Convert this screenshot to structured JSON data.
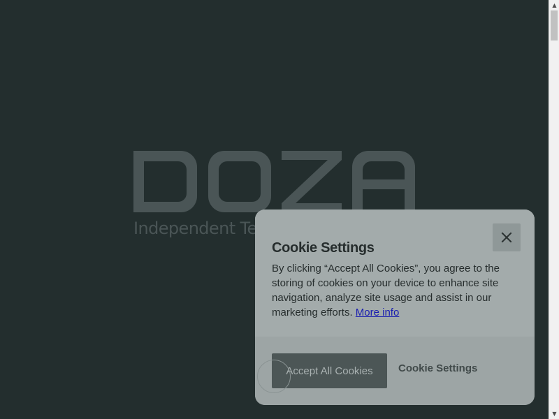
{
  "hero": {
    "logo_text": "DOZA",
    "tagline": "Independent Technology Consultants"
  },
  "cookie_banner": {
    "title": "Cookie Settings",
    "body": "By clicking “Accept All Cookies”, you agree to the storing of cookies on your device to enhance site navigation, analyze site usage and assist in our marketing efforts.",
    "more_info_label": "More info",
    "accept_label": "Accept All Cookies",
    "settings_label": "Cookie Settings",
    "close_icon": "close-icon"
  },
  "colors": {
    "page_background": "#232e2e",
    "logo": "#4a5556",
    "banner_background": "#a3abab",
    "accept_button": "#4c5656",
    "link": "#1b1fb0"
  }
}
